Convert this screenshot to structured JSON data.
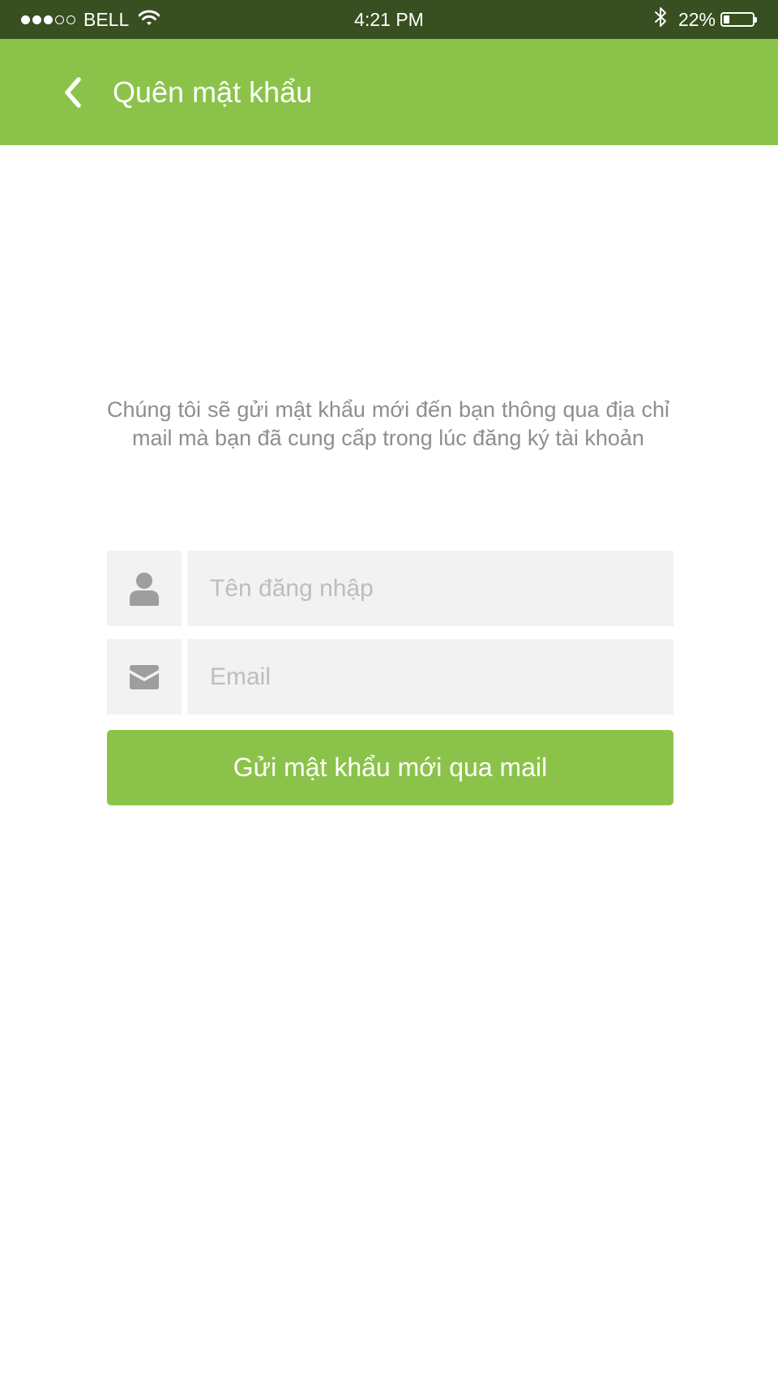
{
  "status_bar": {
    "signal": "●●●○○",
    "carrier": "BELL",
    "time": "4:21 PM",
    "battery_percent": "22%",
    "battery_level": 0.22,
    "icons": [
      "wifi-icon",
      "bluetooth-icon",
      "battery-icon"
    ]
  },
  "header": {
    "back_icon": "chevron-left-icon",
    "title": "Quên mật khẩu",
    "background_color": "#8bc34a"
  },
  "main": {
    "description": "Chúng tôi sẽ gửi mật khẩu mới đến bạn thông qua địa chỉ mail mà bạn đã cung cấp trong lúc đăng ký tài khoản",
    "username": {
      "icon": "user-icon",
      "value": "",
      "placeholder": "Tên đăng nhập"
    },
    "email": {
      "icon": "envelope-icon",
      "value": "",
      "placeholder": "Email"
    },
    "submit_label": "Gửi mật khẩu mới qua mail"
  },
  "colors": {
    "accent": "#8bc34a",
    "status_bar": "#384f21",
    "field_background": "#f2f2f2",
    "icon": "#9e9e9e",
    "description_text": "#8e8e8e"
  }
}
